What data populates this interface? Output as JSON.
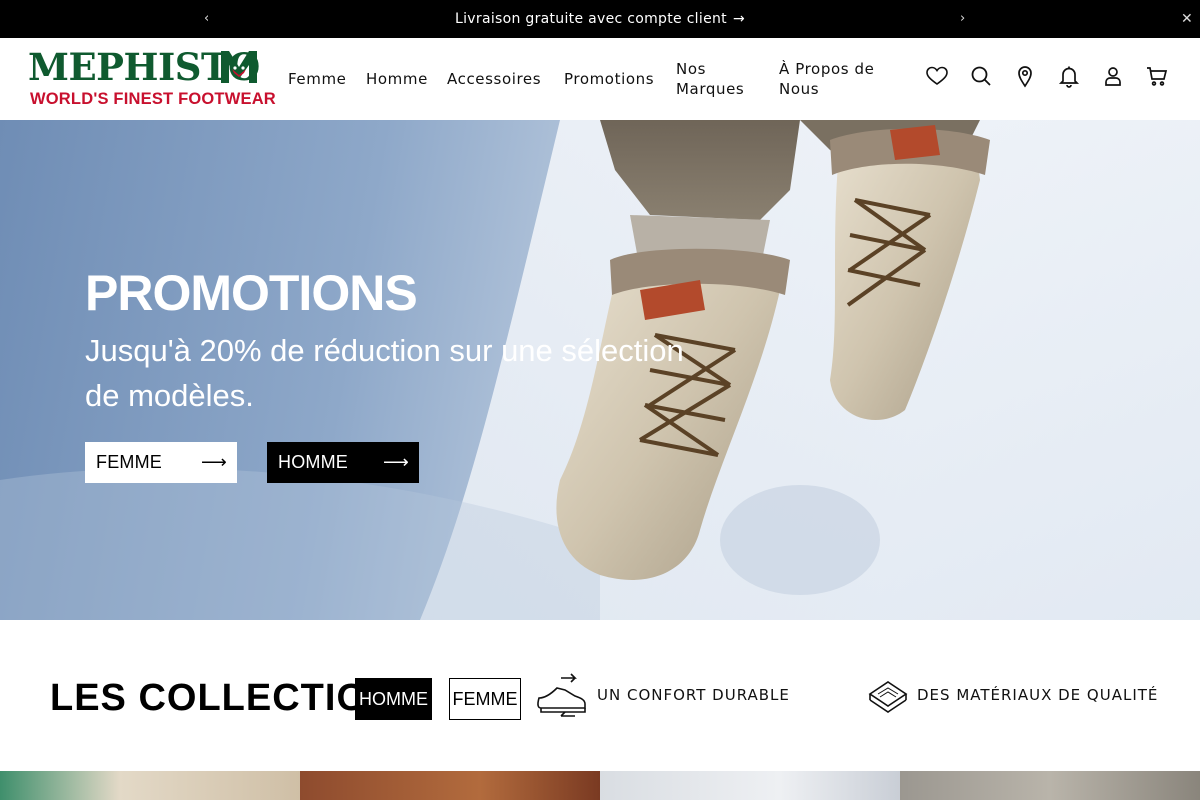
{
  "announcement": {
    "message": "Livraison gratuite avec compte client",
    "arrow_icon": "arrow-right-icon",
    "prev_icon": "chevron-left-icon",
    "next_icon": "chevron-right-icon",
    "close_icon": "close-icon"
  },
  "brand": {
    "name": "MEPHISTO",
    "tagline": "WORLD'S FINEST FOOTWEAR",
    "primary_color": "#0f5a2f",
    "accent_color": "#c8102e"
  },
  "nav": {
    "items": [
      {
        "label": "Femme"
      },
      {
        "label": "Homme"
      },
      {
        "label": "Accessoires"
      },
      {
        "label": "Promotions"
      },
      {
        "label": "Nos Marques"
      },
      {
        "label": "À Propos de Nous"
      }
    ]
  },
  "header_icons": [
    "heart-icon",
    "search-icon",
    "location-pin-icon",
    "bell-icon",
    "user-icon",
    "cart-icon"
  ],
  "hero": {
    "title": "PROMOTIONS",
    "subtitle": "Jusqu'à 20% de réduction sur une sélection de modèles.",
    "buttons": [
      {
        "label": "FEMME",
        "arrow": "⟶"
      },
      {
        "label": "HOMME",
        "arrow": "⟶"
      }
    ]
  },
  "collections": {
    "title": "LES COLLECTIONS",
    "tabs": [
      {
        "label": "HOMME",
        "active": true
      },
      {
        "label": "FEMME",
        "active": false
      }
    ],
    "features": [
      {
        "icon": "comfort-shoe-icon",
        "label": "UN CONFORT DURABLE"
      },
      {
        "icon": "material-layers-icon",
        "label": "DES MATÉRIAUX DE QUALITÉ"
      }
    ]
  }
}
